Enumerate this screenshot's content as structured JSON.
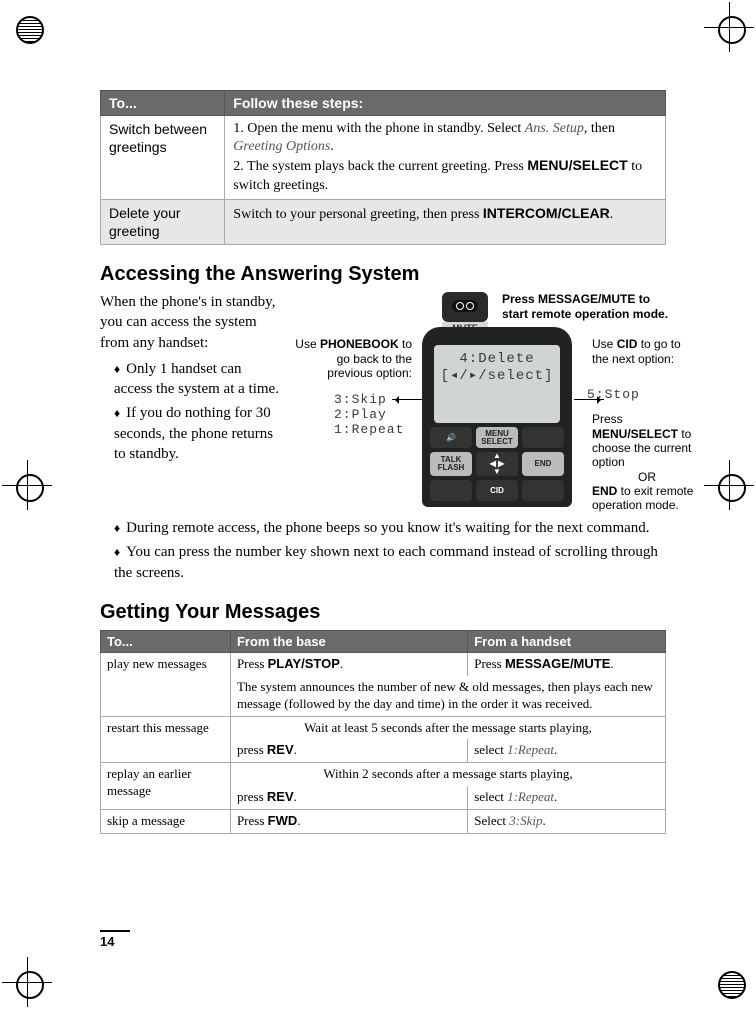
{
  "table1": {
    "headers": [
      "To...",
      "Follow these steps:"
    ],
    "rows": [
      {
        "label": "Switch between greetings",
        "step1_pre": "1. Open the menu with the phone in standby. Select ",
        "step1_path1": "Ans. Setup",
        "step1_mid": ", then ",
        "step1_path2": "Greeting Options",
        "step1_post": ".",
        "step2_pre": "2. The system plays back the current greeting. Press ",
        "step2_key": "MENU/SELECT",
        "step2_post": " to switch greetings."
      },
      {
        "label": "Delete your greeting",
        "text_pre": "Switch to your personal greeting, then press ",
        "text_key": "INTERCOM/CLEAR",
        "text_post": "."
      }
    ]
  },
  "section1_title": "Accessing the Answering System",
  "section1_intro": "When the phone's in standby, you can access the system from any handset:",
  "section1_bullets_left": [
    "Only 1 handset can access the system at a time.",
    "If you do nothing for 30 seconds, the phone returns to standby."
  ],
  "section1_bullets_full": [
    "During remote access, the phone beeps so you know it's waiting for the next command.",
    "You can press the number key shown next to each command instead of scrolling through the screens."
  ],
  "diagram": {
    "mute_label": "MUTE",
    "screen_line1": "4:Delete",
    "screen_line2": "[◂/▸/select]",
    "lcd_left": [
      "3:Skip",
      "2:Play",
      "1:Repeat"
    ],
    "lcd_right": "5:Stop",
    "callout_top_pre": "Press ",
    "callout_top_key": "MESSAGE/MUTE",
    "callout_top_post": " to start remote operation mode.",
    "callout_left_pre": "Use ",
    "callout_left_key": "PHONEBOOK",
    "callout_left_post": " to go back to the previous option:",
    "callout_right1_pre": "Use ",
    "callout_right1_key": "CID",
    "callout_right1_post": " to go to the next option:",
    "callout_right2_pre": "Press ",
    "callout_right2_key": "MENU/SELECT",
    "callout_right2_post": " to choose the current option",
    "callout_right2_or": "OR",
    "callout_right2_end_key": "END",
    "callout_right2_end_post": " to exit remote operation mode.",
    "key_labels": [
      "",
      "MENU SELECT",
      "",
      "TALK FLASH",
      "",
      "END",
      "",
      "CID",
      ""
    ]
  },
  "section2_title": "Getting Your Messages",
  "table2": {
    "headers": [
      "To...",
      "From the base",
      "From a handset"
    ],
    "row1": {
      "label": "play new messages",
      "base_pre": "Press ",
      "base_key": "PLAY/STOP",
      "base_post": ".",
      "hs_pre": "Press ",
      "hs_key": "MESSAGE/MUTE",
      "hs_post": ".",
      "shared": "The system announces the number of new & old messages, then plays each new message (followed by the day and time) in the order it was received."
    },
    "row2": {
      "label": "restart this message",
      "lead": "Wait at least 5 seconds after the message starts playing,",
      "base_pre": "press ",
      "base_key": "REV",
      "base_post": ".",
      "hs_pre": "select ",
      "hs_path": "1:Repeat",
      "hs_post": "."
    },
    "row3": {
      "label": "replay an earlier message",
      "lead": "Within 2 seconds after a message starts playing,",
      "base_pre": "press ",
      "base_key": "REV",
      "base_post": ".",
      "hs_pre": "select ",
      "hs_path": "1:Repeat",
      "hs_post": "."
    },
    "row4": {
      "label": "skip a message",
      "base_pre": "Press ",
      "base_key": "FWD",
      "base_post": ".",
      "hs_pre": "Select ",
      "hs_path": "3:Skip",
      "hs_post": "."
    }
  },
  "page_number": "14"
}
